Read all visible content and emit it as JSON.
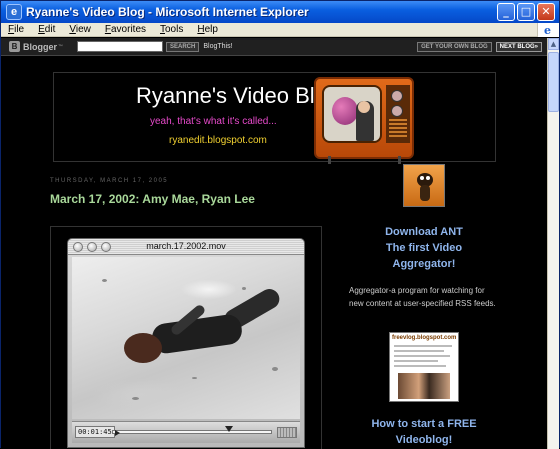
{
  "window": {
    "title": "Ryanne's Video Blog - Microsoft Internet Explorer",
    "minimize": "_",
    "maximize": "□",
    "close": "✕"
  },
  "menu": [
    "File",
    "Edit",
    "View",
    "Favorites",
    "Tools",
    "Help"
  ],
  "blogger_bar": {
    "logo": "Blogger",
    "search_button": "SEARCH",
    "blog_this": "BlogThis!",
    "get_blog": "GET YOUR OWN BLOG",
    "next_blog": "NEXT BLOG»"
  },
  "header": {
    "title": "Ryanne's Video Blog",
    "tagline": "yeah, that's what it's called...",
    "url": "ryanedit.blogspot.com"
  },
  "post": {
    "date": "THURSDAY, MARCH 17, 2005",
    "title": "March 17, 2002: Amy Mae, Ryan Lee",
    "video": {
      "filename": "march.17.2002.mov",
      "timecode": "00:01:45",
      "progress_fraction": 0.74
    }
  },
  "sidebar": {
    "download_heading": [
      "Download ANT",
      "The first Video",
      "Aggregator!"
    ],
    "description": "Aggregator-a program for watching for new content at user-specified RSS feeds.",
    "freevlog_caption": "freevlog.blogspot.com",
    "howto_heading": [
      "How to start a FREE",
      "Videoblog!"
    ]
  },
  "colors": {
    "title_bar": "#0a5fe0",
    "post_title": "#a9d89a",
    "sidebar_link": "#8fb5ec",
    "tagline": "#e74acb",
    "url": "#f0d030"
  }
}
